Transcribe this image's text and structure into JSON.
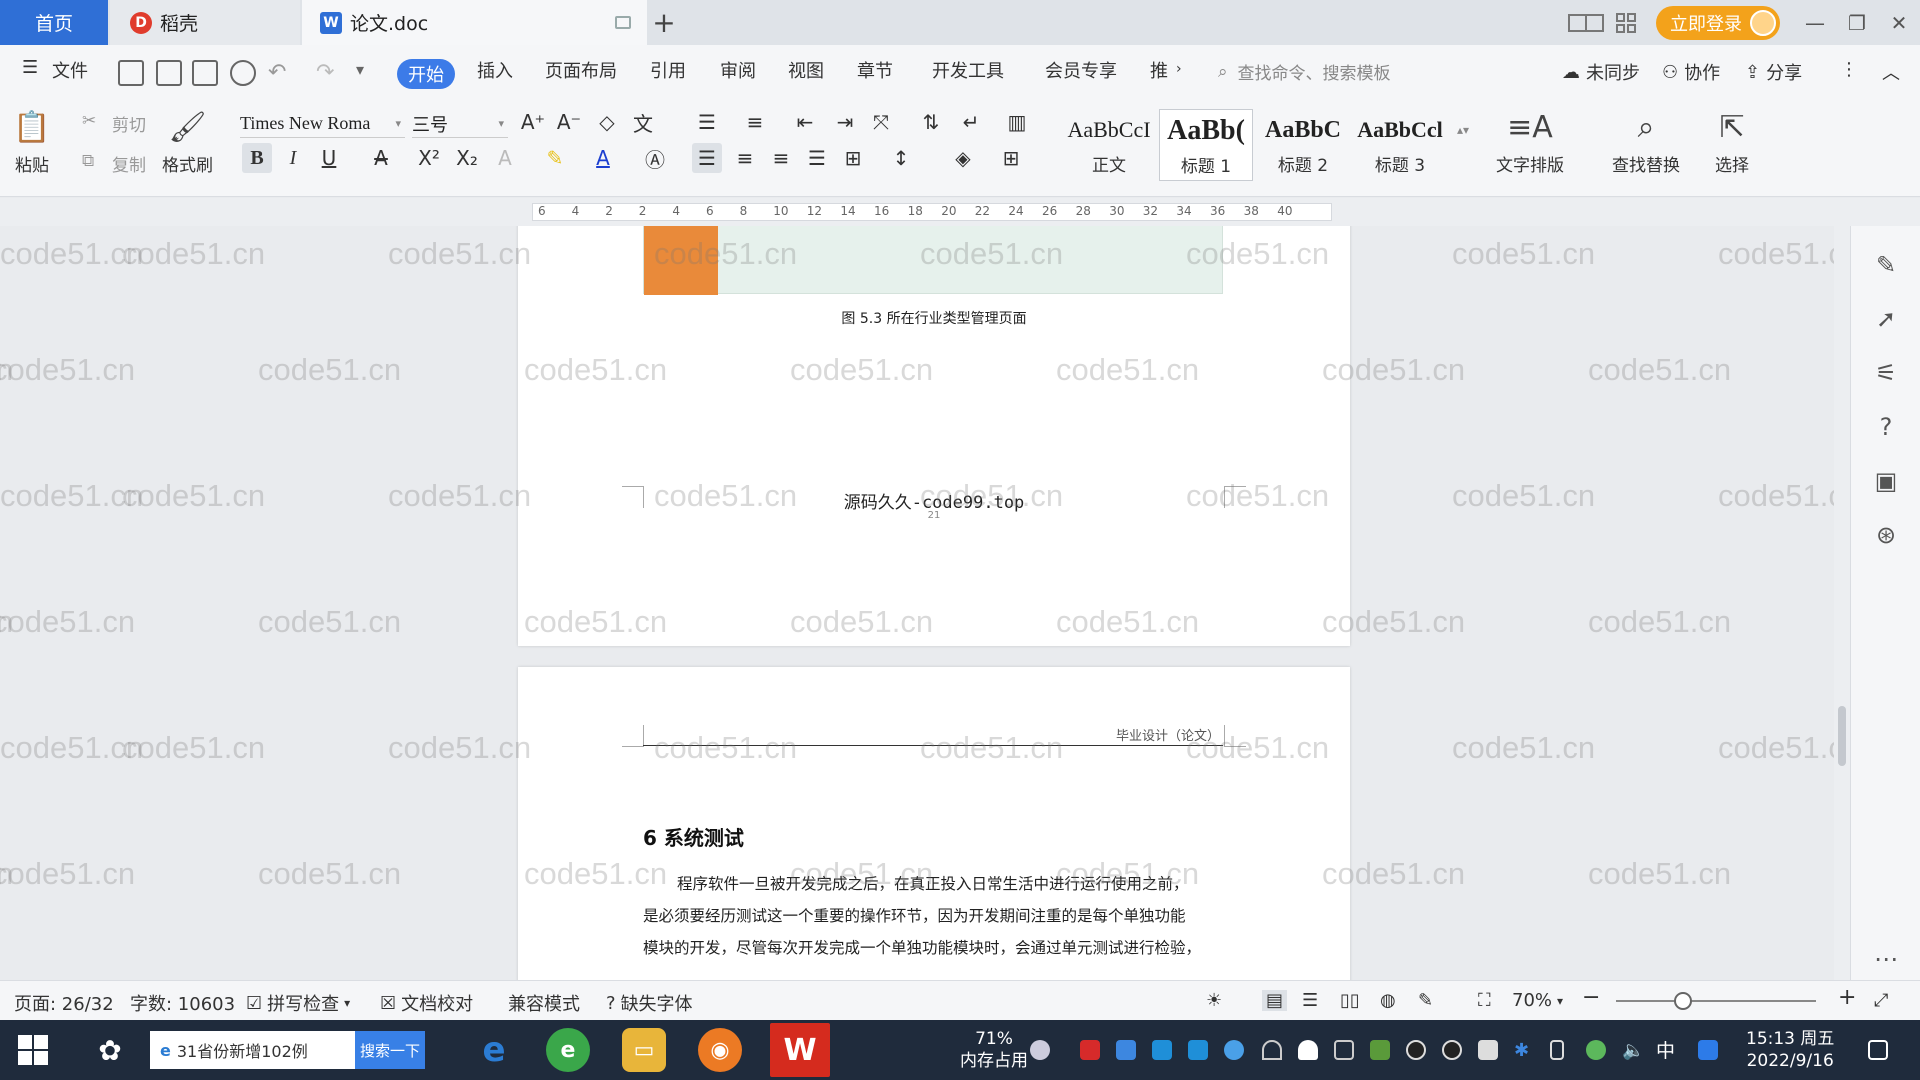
{
  "tabs": {
    "home": "首页",
    "daoke": "稻壳",
    "document": "论文.doc",
    "login": "立即登录"
  },
  "menu": [
    "文件",
    "开始",
    "插入",
    "页面布局",
    "引用",
    "审阅",
    "视图",
    "章节",
    "开发工具",
    "会员专享",
    "推"
  ],
  "menu_right": {
    "search_cmd": "查找命令、搜索模板",
    "unsynced": "未同步",
    "collaborate": "协作",
    "share": "分享"
  },
  "ribbon": {
    "paste": "粘贴",
    "cut": "剪切",
    "copy": "复制",
    "format_painter": "格式刷",
    "font_name": "Times New Roma",
    "font_size": "三号",
    "styles": [
      {
        "preview": "AaBbCcI",
        "name": "正文"
      },
      {
        "preview": "AaBb(",
        "name": "标题 1"
      },
      {
        "preview": "AaBbC",
        "name": "标题 2"
      },
      {
        "preview": "AaBbCcl",
        "name": "标题 3"
      }
    ],
    "text_layout": "文字排版",
    "find_replace": "查找替换",
    "select": "选择"
  },
  "ruler_numbers": [
    "6",
    "4",
    "2",
    "2",
    "4",
    "6",
    "8",
    "10",
    "12",
    "14",
    "16",
    "18",
    "20",
    "22",
    "24",
    "26",
    "28",
    "30",
    "32",
    "34",
    "36",
    "38",
    "40"
  ],
  "document": {
    "figure_caption": "图 5.3 所在行业类型管理页面",
    "footer_text": "源码久久-code99.top",
    "page_number": "21",
    "header_text": "毕业设计（论文）",
    "chapter_title": "6  系统测试",
    "paragraphs": [
      "程序软件一旦被开发完成之后，在真正投入日常生活中进行运行使用之前，",
      "是必须要经历测试这一个重要的操作环节，因为开发期间注重的是每个单独功能",
      "模块的开发，尽管每次开发完成一个单独功能模块时，会通过单元测试进行检验，"
    ]
  },
  "watermark": "code51.cn",
  "status": {
    "page": "页面: 26/32",
    "words": "字数: 10603",
    "spell": "拼写检查",
    "proof": "文档校对",
    "compat": "兼容模式",
    "missing_font": "缺失字体",
    "zoom": "70%"
  },
  "taskbar": {
    "search_text": "31省份新增102例",
    "search_button": "搜索一下",
    "mem_percent": "71%",
    "mem_label": "内存占用",
    "ime": "中",
    "time": "15:13 周五",
    "date": "2022/9/16"
  }
}
